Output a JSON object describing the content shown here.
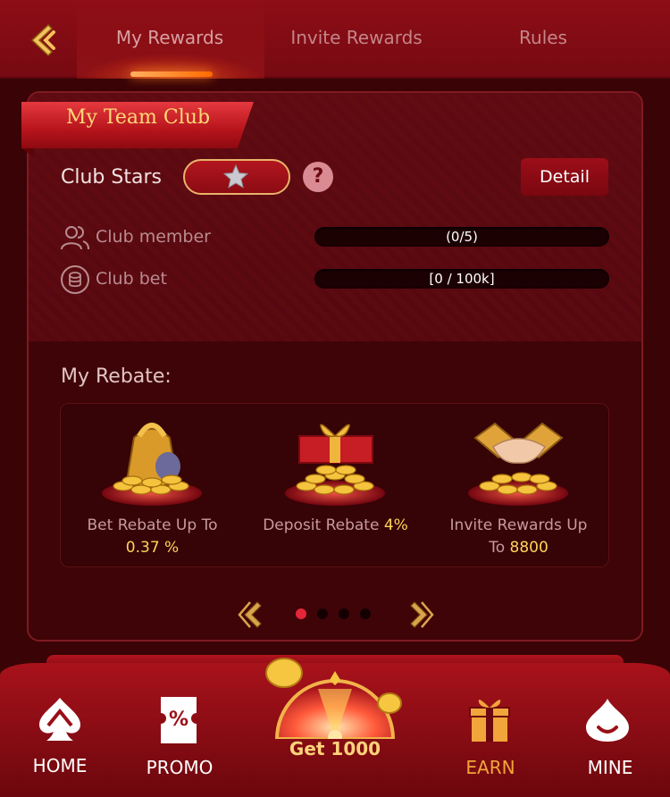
{
  "header": {
    "tabs": [
      {
        "label": "My Rewards",
        "active": true
      },
      {
        "label": "Invite Rewards",
        "active": false
      },
      {
        "label": "Rules",
        "active": false
      }
    ]
  },
  "club": {
    "title": "My Team Club",
    "stars_label": "Club Stars",
    "help_symbol": "?",
    "detail_label": "Detail",
    "stats": [
      {
        "label": "Club member",
        "value": "(0/5)",
        "progress": 0
      },
      {
        "label": "Club bet",
        "value": "[0 / 100k]",
        "progress": 0
      }
    ]
  },
  "rebate": {
    "title": "My Rebate:",
    "items": [
      {
        "line1": "Bet Rebate Up To",
        "value": "0.37 %",
        "icon": "money-bag-icon"
      },
      {
        "line1": "Deposit Rebate ",
        "value": "4%",
        "icon": "gift-box-coins-icon"
      },
      {
        "line1": "Invite Rewards Up",
        "line2": "To ",
        "value": "8800",
        "icon": "handshake-coins-icon"
      }
    ],
    "pager": {
      "pages": 4,
      "current": 1
    }
  },
  "bottom_nav": {
    "items": [
      {
        "label": "HOME",
        "icon": "spade-icon",
        "active": false
      },
      {
        "label": "PROMO",
        "icon": "coupon-icon",
        "active": false
      },
      {
        "label": "Get 1000",
        "icon": "lucky-wheel-icon",
        "active": false
      },
      {
        "label": "EARN",
        "icon": "gift-icon",
        "active": true
      },
      {
        "label": "MINE",
        "icon": "smile-drop-icon",
        "active": false
      }
    ]
  },
  "colors": {
    "accent": "#ffd35a",
    "earn_active": "#f2a53a",
    "header_bg": "#8e0d16",
    "panel_bg": "#470508"
  }
}
